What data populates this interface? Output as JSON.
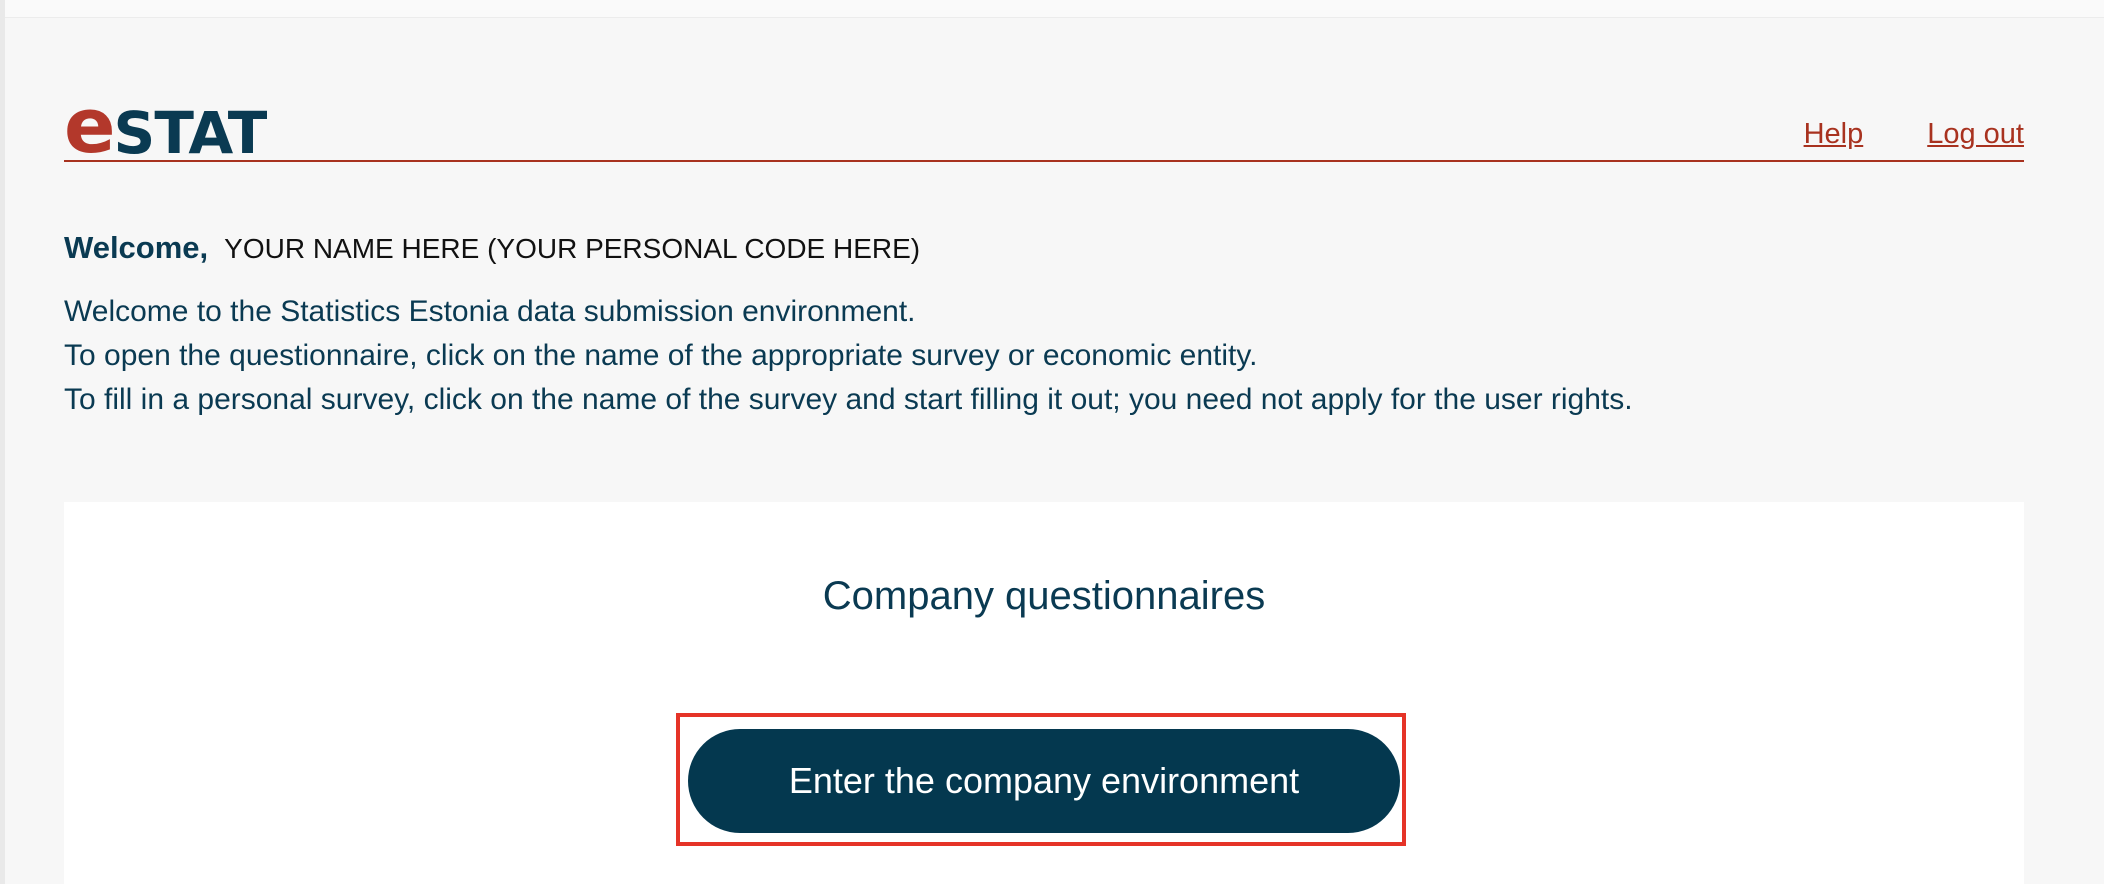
{
  "header": {
    "logo_e": "e",
    "logo_stat": "STAT",
    "nav": {
      "help": "Help",
      "logout": "Log out"
    }
  },
  "welcome": {
    "label": "Welcome,",
    "name": "YOUR NAME HERE (YOUR PERSONAL CODE HERE)"
  },
  "intro": {
    "lines": [
      "Welcome to the Statistics Estonia data submission environment.",
      "To open the questionnaire, click on the name of the appropriate survey or economic entity.",
      "To fill in a personal survey, click on the name of the survey and start filling it out; you need not apply for the user rights."
    ]
  },
  "card": {
    "title": "Company questionnaires",
    "button_label": "Enter the company environment"
  },
  "colors": {
    "primary": "#04384f",
    "accent": "#a8321f",
    "highlight": "#e53327"
  }
}
